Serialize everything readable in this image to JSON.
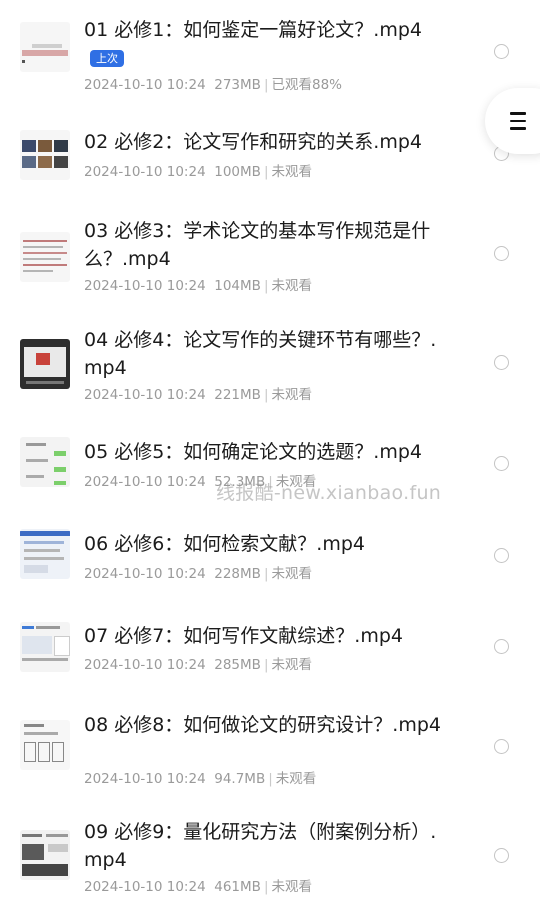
{
  "items": [
    {
      "title": "01 必修1：如何鉴定一篇好论文？.mp4",
      "tag": "上次",
      "date": "2024-10-10 10:24",
      "size": "273MB",
      "status": "已观看88%"
    },
    {
      "title": "02 必修2：论文写作和研究的关系.mp4",
      "date": "2024-10-10 10:24",
      "size": "100MB",
      "status": "未观看"
    },
    {
      "title": "03 必修3：学术论文的基本写作规范是什么？.mp4",
      "date": "2024-10-10 10:24",
      "size": "104MB",
      "status": "未观看"
    },
    {
      "title": "04 必修4：论文写作的关键环节有哪些？.mp4",
      "date": "2024-10-10 10:24",
      "size": "221MB",
      "status": "未观看"
    },
    {
      "title": "05 必修5：如何确定论文的选题？.mp4",
      "date": "2024-10-10 10:24",
      "size": "52.3MB",
      "status": "未观看"
    },
    {
      "title": "06 必修6：如何检索文献？.mp4",
      "date": "2024-10-10 10:24",
      "size": "228MB",
      "status": "未观看"
    },
    {
      "title": "07 必修7：如何写作文献综述？.mp4",
      "date": "2024-10-10 10:24",
      "size": "285MB",
      "status": "未观看"
    },
    {
      "title": "08 必修8：如何做论文的研究设计？.mp4",
      "date": "2024-10-10 10:24",
      "size": "94.7MB",
      "status": "未观看"
    },
    {
      "title": "09 必修9：量化研究方法（附案例分析）.mp4",
      "date": "2024-10-10 10:24",
      "size": "461MB",
      "status": "未观看"
    }
  ],
  "watermark": "线报酷-new.xianbao.fun",
  "icons": {
    "menu": "menu-icon",
    "select": "radio-circle"
  },
  "colors": {
    "tag": "#2f6fe4",
    "title": "#1b1b1b",
    "meta": "#9a9a9a"
  }
}
